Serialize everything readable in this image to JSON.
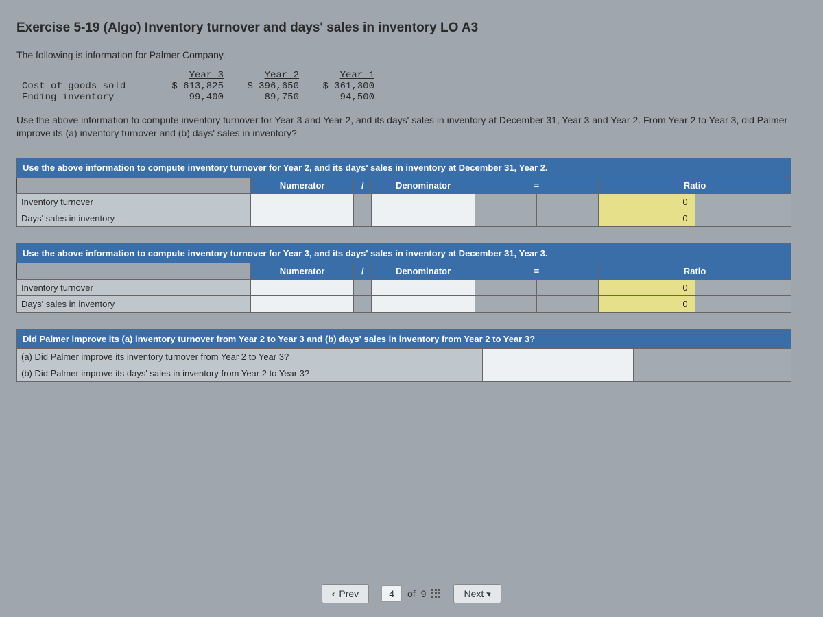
{
  "title": "Exercise 5-19 (Algo) Inventory turnover and days' sales in inventory LO A3",
  "intro": "The following is information for Palmer Company.",
  "data_matrix": {
    "headers": [
      "Year 3",
      "Year 2",
      "Year 1"
    ],
    "rows": [
      {
        "label": "Cost of goods sold",
        "y3": "$ 613,825",
        "y2": "$ 396,650",
        "y1": "$ 361,300"
      },
      {
        "label": "Ending inventory",
        "y3": "99,400",
        "y2": "89,750",
        "y1": "94,500"
      }
    ]
  },
  "prompt": "Use the above information to compute inventory turnover for Year 3 and Year 2, and its days' sales in inventory at December 31, Year 3 and Year 2. From Year 2 to Year 3, did Palmer improve its (a) inventory turnover and (b) days' sales in inventory?",
  "ws_cols": {
    "numerator": "Numerator",
    "slash": "/",
    "denominator": "Denominator",
    "equals": "=",
    "ratio": "Ratio"
  },
  "year2": {
    "section_title": "Use the above information to compute inventory turnover for Year 2, and its days' sales in inventory at December 31, Year 2.",
    "rows": [
      {
        "label": "Inventory turnover",
        "ratio": "0"
      },
      {
        "label": "Days' sales in inventory",
        "ratio": "0"
      }
    ]
  },
  "year3": {
    "section_title": "Use the above information to compute inventory turnover for Year 3, and its days' sales in inventory at December 31, Year 3.",
    "rows": [
      {
        "label": "Inventory turnover",
        "ratio": "0"
      },
      {
        "label": "Days' sales in inventory",
        "ratio": "0"
      }
    ]
  },
  "improve": {
    "section_title": "Did Palmer improve its (a) inventory turnover from Year 2 to Year 3 and (b) days' sales in inventory from Year 2 to Year 3?",
    "q_a": "(a) Did Palmer improve its inventory turnover from Year 2 to Year 3?",
    "q_b": "(b) Did Palmer improve its days' sales in inventory from Year 2 to Year 3?"
  },
  "footer": {
    "prev": "Prev",
    "next": "Next",
    "current": "4",
    "of_label": "of",
    "total": "9"
  }
}
